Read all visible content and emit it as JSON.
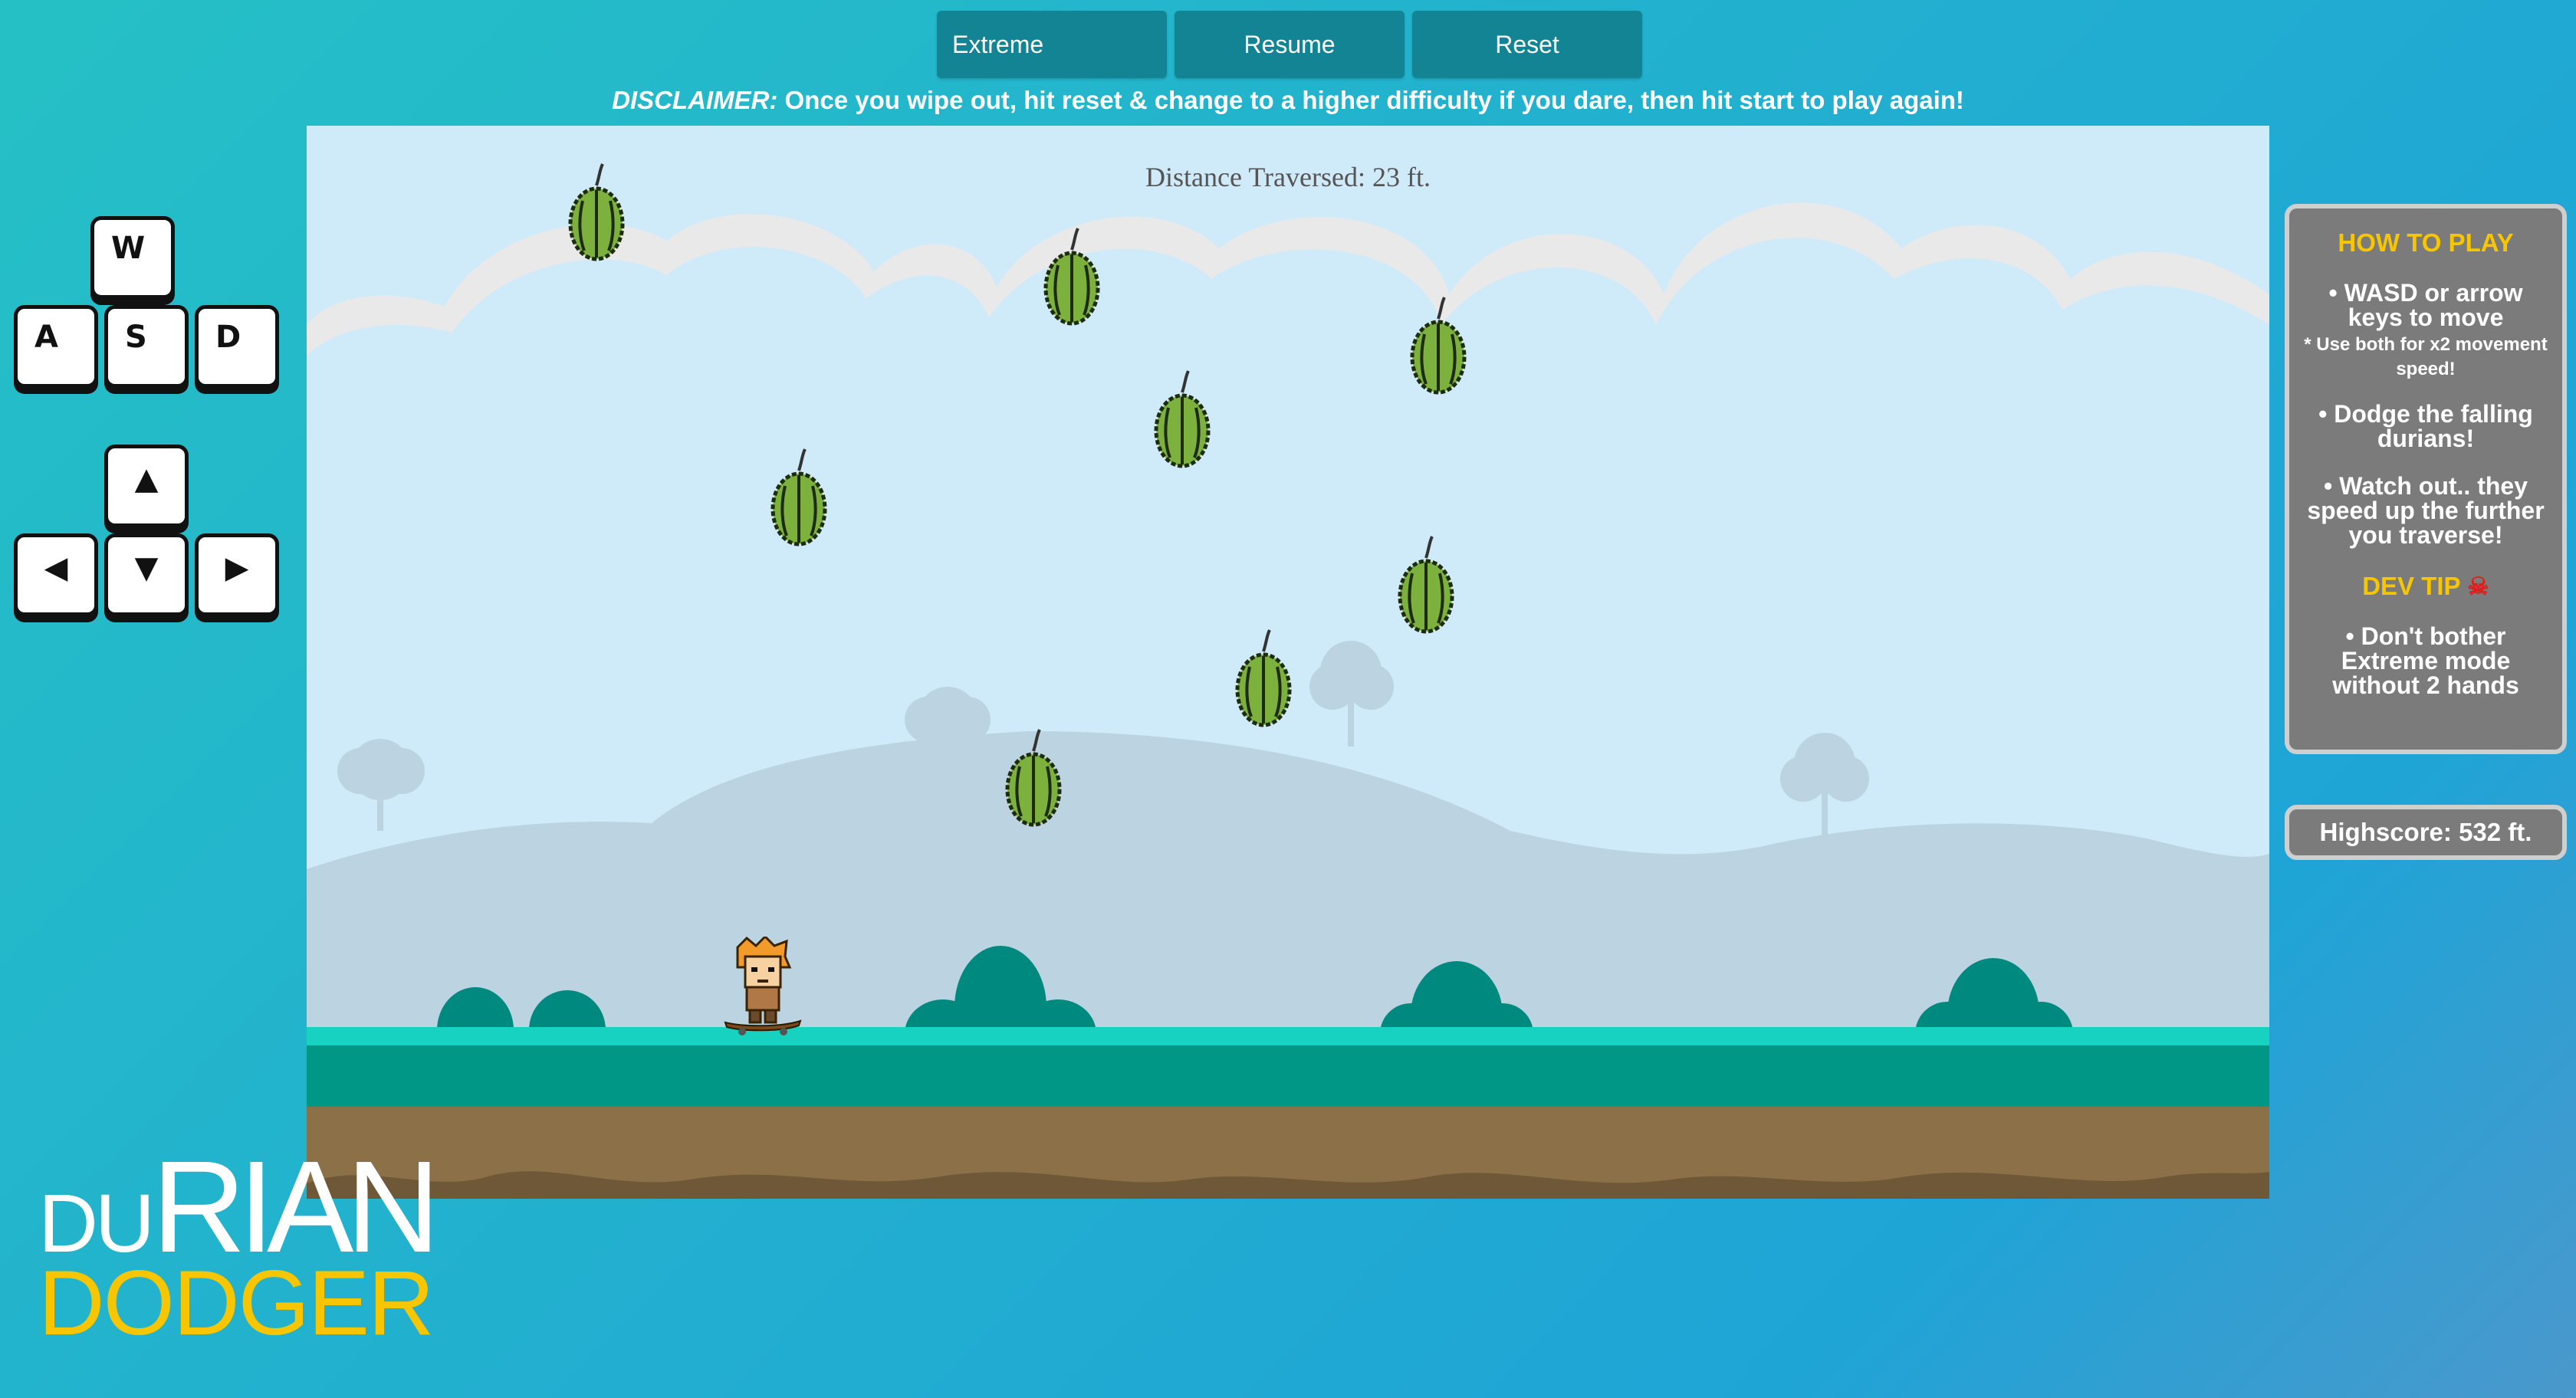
{
  "controls": {
    "extreme_label": "Extreme",
    "resume_label": "Resume",
    "reset_label": "Reset"
  },
  "disclaimer": {
    "lead": "DISCLAIMER:",
    "text": " Once you wipe out, hit reset & change to a higher difficulty if you dare, then hit start to play again!"
  },
  "game": {
    "distance_text": "Distance Traversed: 23 ft."
  },
  "keys": {
    "wasd": [
      "W",
      "A",
      "S",
      "D"
    ],
    "arrows": [
      "▲",
      "◀",
      "▼",
      "▶"
    ]
  },
  "how_to_play": {
    "title": "HOW TO PLAY",
    "line1": "• WASD or arrow keys to move",
    "line1_note": "* Use both for x2 movement speed!",
    "line2": "• Dodge the falling durians!",
    "line3": "• Watch out.. they speed up the further you traverse!",
    "dev_tip_title": "DEV TIP",
    "dev_tip": "• Don't bother Extreme mode without 2 hands"
  },
  "highscore_text": "Highscore: 532 ft.",
  "logo": {
    "line1_small": "DU",
    "line1_big": "RIAN",
    "line2": "DODGER"
  },
  "colors": {
    "button": "#138493",
    "panel": "#7b7b7b",
    "accent_yellow": "#f7c600",
    "grass": "#009787",
    "dirt": "#8c7048"
  }
}
